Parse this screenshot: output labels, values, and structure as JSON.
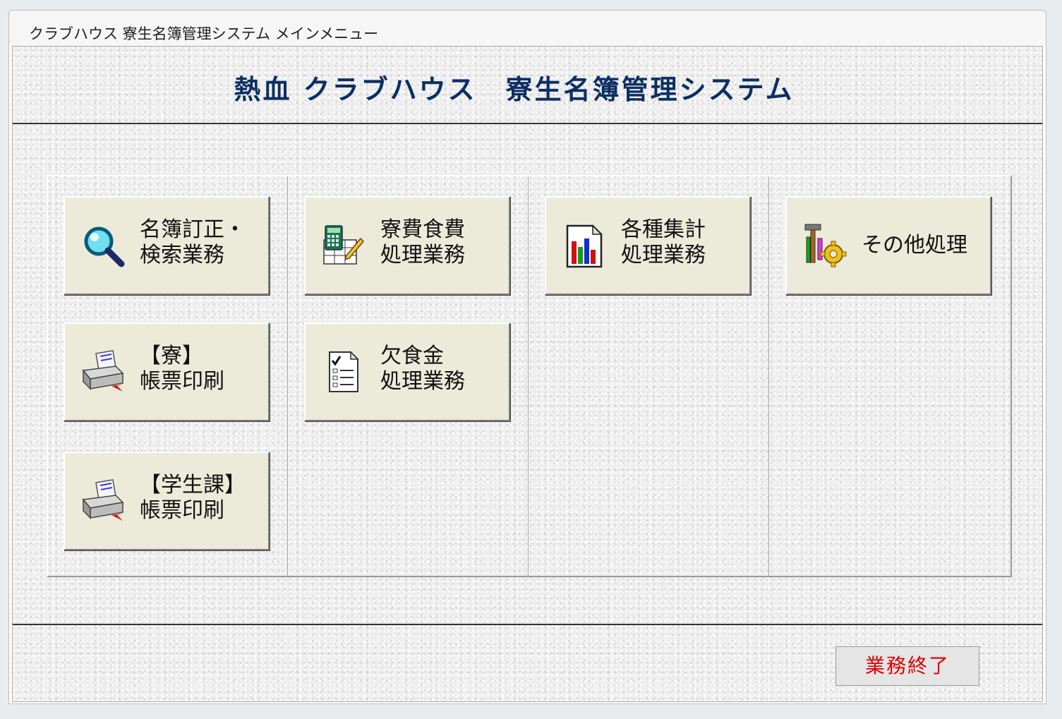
{
  "window": {
    "title": "クラブハウス 寮生名簿管理システム メインメニュー"
  },
  "header": {
    "title": "熱血 クラブハウス　寮生名簿管理システム"
  },
  "buttons": {
    "roster_search": {
      "label": "名簿訂正・\n検索業務",
      "icon": "magnifier-icon"
    },
    "dorm_print": {
      "label": "【寮】\n帳票印刷",
      "icon": "printer-icon"
    },
    "student_print": {
      "label": "【学生課】\n帳票印刷",
      "icon": "printer-icon"
    },
    "fee_processing": {
      "label": "寮費食費\n処理業務",
      "icon": "calculator-icon"
    },
    "absence_refund": {
      "label": "欠食金\n処理業務",
      "icon": "checklist-icon"
    },
    "statistics": {
      "label": "各種集計\n処理業務",
      "icon": "bar-chart-icon"
    },
    "other": {
      "label": "その他処理",
      "icon": "tools-icon"
    }
  },
  "footer": {
    "exit_label": "業務終了"
  },
  "colors": {
    "title_text": "#0b2f63",
    "exit_text": "#e00000",
    "button_face": "#ecead9"
  }
}
